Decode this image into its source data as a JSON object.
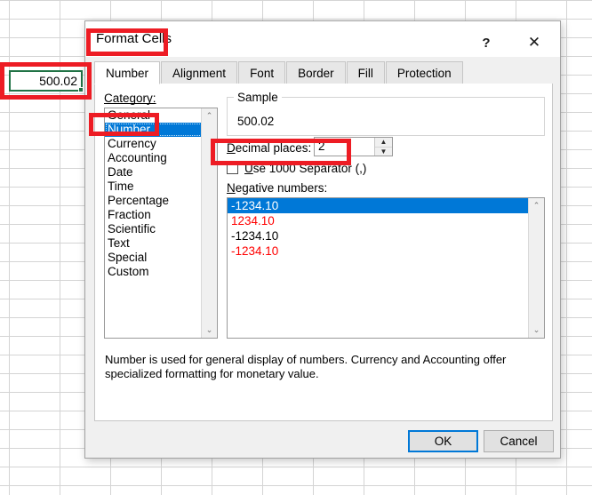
{
  "spreadsheet": {
    "selected_cell_value": "500.02"
  },
  "dialog": {
    "title": "Format Cells",
    "help_icon": "?",
    "close_icon": "✕",
    "tabs": [
      {
        "label": "Number",
        "active": true
      },
      {
        "label": "Alignment",
        "active": false
      },
      {
        "label": "Font",
        "active": false
      },
      {
        "label": "Border",
        "active": false
      },
      {
        "label": "Fill",
        "active": false
      },
      {
        "label": "Protection",
        "active": false
      }
    ],
    "category": {
      "label": "Category:",
      "items": [
        "General",
        "Number",
        "Currency",
        "Accounting",
        "Date",
        "Time",
        "Percentage",
        "Fraction",
        "Scientific",
        "Text",
        "Special",
        "Custom"
      ],
      "selected": "Number",
      "scroll_up_icon": "⌃",
      "scroll_down_icon": "⌄"
    },
    "sample": {
      "legend": "Sample",
      "value": "500.02"
    },
    "decimal_places": {
      "label": "Decimal places:",
      "value": "2",
      "spin_up_icon": "▲",
      "spin_down_icon": "▼"
    },
    "thousands_separator": {
      "label": "Use 1000 Separator (,)",
      "checked": false
    },
    "negative_numbers": {
      "label": "Negative numbers:",
      "items": [
        {
          "text": "-1234.10",
          "color": "#ffffff",
          "selected": true
        },
        {
          "text": "1234.10",
          "color": "#ff0000",
          "selected": false
        },
        {
          "text": "-1234.10",
          "color": "#000000",
          "selected": false
        },
        {
          "text": "-1234.10",
          "color": "#ff0000",
          "selected": false
        }
      ],
      "scroll_up_icon": "⌃",
      "scroll_down_icon": "⌄"
    },
    "description": "Number is used for general display of numbers.  Currency and Accounting offer specialized formatting for monetary value.",
    "buttons": {
      "ok": "OK",
      "cancel": "Cancel"
    }
  },
  "annotations": {
    "accent_color": "#ed1c24",
    "boxes": [
      "selected-cell-highlight",
      "dialog-title-highlight",
      "category-number-highlight",
      "decimal-places-highlight"
    ]
  }
}
